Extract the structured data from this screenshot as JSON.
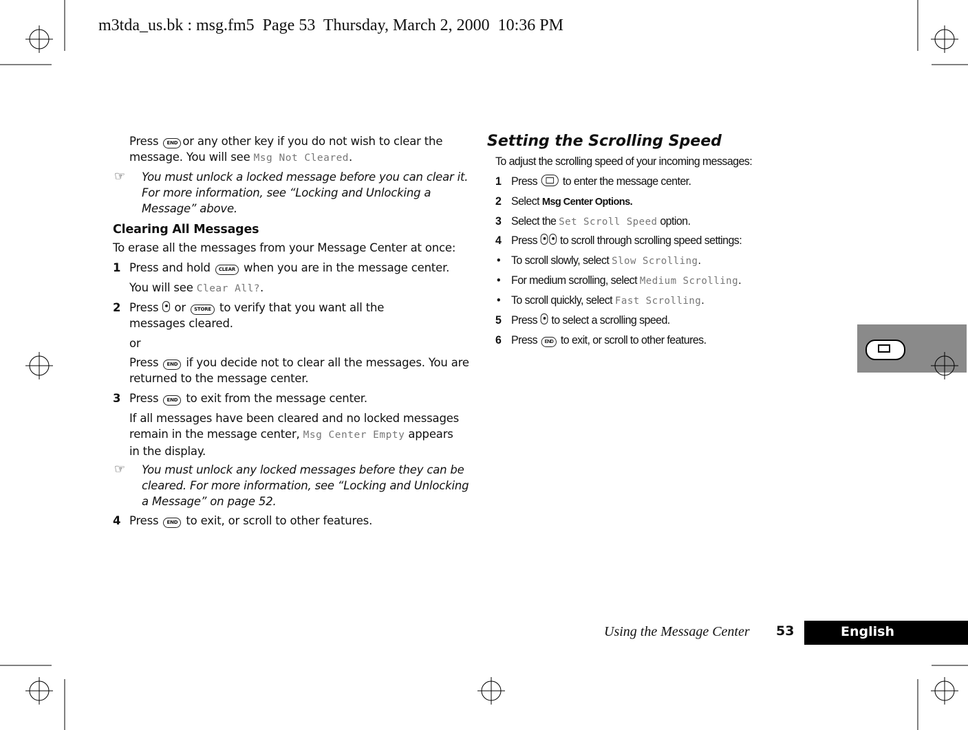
{
  "header": {
    "slug": "m3tda_us.bk : msg.fm5  Page 53  Thursday, March 2, 2000  10:36 PM"
  },
  "left": {
    "p1_a": "Press ",
    "p1_key": "END",
    "p1_b": "or any other key if you do not wish to clear the message. You will see ",
    "p1_lcd": "Msg Not Cleared",
    "p1_c": ".",
    "note1": "You must unlock a locked message before you can clear it. For more information, see “Locking and Unlocking a Message”  above.",
    "heading": "Clearing All Messages",
    "intro": "To erase all the messages from your Message Center at once:",
    "s1_num": "1",
    "s1_a": "Press and hold ",
    "s1_key": "CLEAR",
    "s1_b": " when you are in the message center.",
    "s1_see": "You will see ",
    "s1_lcd": "Clear All?",
    "s1_c": ".",
    "s2_num": "2",
    "s2_a": "Press ",
    "s2_b": " or ",
    "s2_key": "STORE",
    "s2_c": " to verify that you want all the messages cleared.",
    "or": "or",
    "alt_a": "Press ",
    "alt_key": "END",
    "alt_b": " if you decide not to clear all the messages. You are returned to the message center.",
    "s3_num": "3",
    "s3_a": "Press ",
    "s3_key": "END",
    "s3_b": " to exit from the message center.",
    "s3_c": "If all messages have been cleared and no locked messages remain in the message center, ",
    "s3_lcd": "Msg Center Empty",
    "s3_d": " appears in the display.",
    "note2": "You must unlock any locked messages before they can be cleared. For more information, see “Locking and Unlocking a Message” on page 52.",
    "s4_num": "4",
    "s4_a": "Press ",
    "s4_key": "END",
    "s4_b": " to exit, or scroll to other features."
  },
  "right": {
    "heading": "Setting the Scrolling Speed",
    "intro": "To adjust the scrolling speed of your incoming messages:",
    "s1_num": "1",
    "s1_a": "Press ",
    "s1_b": " to enter the message center.",
    "s2_num": "2",
    "s2_a": "Select ",
    "s2_bold": "Msg Center Options.",
    "s3_num": "3",
    "s3_a": "Select the ",
    "s3_lcd": "Set Scroll Speed",
    "s3_b": " option.",
    "s4_num": "4",
    "s4_a": "Press ",
    "s4_b": " to scroll through scrolling speed settings:",
    "b1_a": "To scroll slowly, select ",
    "b1_lcd": "Slow Scrolling",
    "b1_b": ".",
    "b2_a": "For medium scrolling, select ",
    "b2_lcd": "Medium Scrolling",
    "b2_b": ".",
    "b3_a": "To scroll quickly, select ",
    "b3_lcd": "Fast Scrolling",
    "b3_b": ".",
    "s5_num": "5",
    "s5_a": "Press ",
    "s5_b": " to select a scrolling speed.",
    "s6_num": "6",
    "s6_a": "Press ",
    "s6_key": "END",
    "s6_b": " to exit, or scroll to other features."
  },
  "footer": {
    "section": "Using the Message Center",
    "page": "53",
    "language": "English"
  },
  "colors": {
    "tab_gray": "#8a8a8a",
    "bar_black": "#000000"
  }
}
